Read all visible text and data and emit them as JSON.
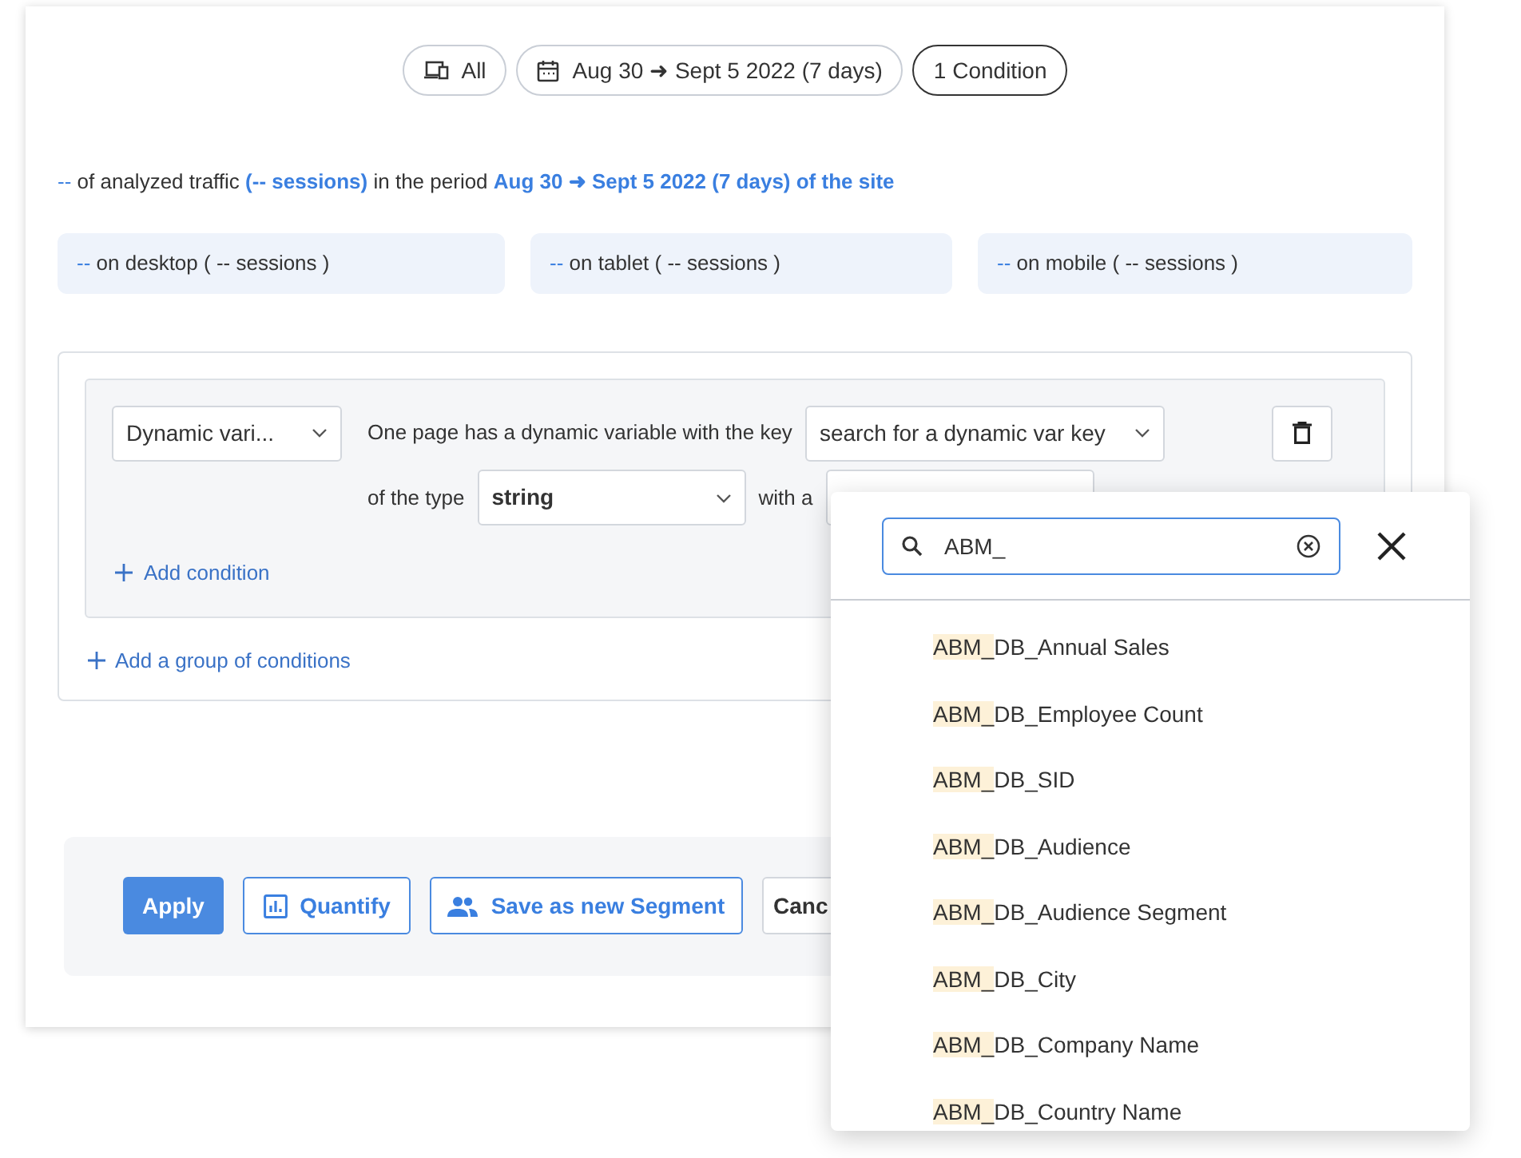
{
  "filters": [
    {
      "kind": "device",
      "label": "All",
      "selected": false
    },
    {
      "kind": "date",
      "label": "Aug 30 ➜ Sept 5 2022 (7 days)",
      "selected": false
    },
    {
      "kind": "condition",
      "label": "1 Condition",
      "selected": true
    }
  ],
  "summary": {
    "value": "--",
    "text1": "of analyzed traffic",
    "sessions": "(-- sessions)",
    "text2": "in the period",
    "period": "Aug 30 ➜ Sept 5 2022 (7 days) of the site"
  },
  "devices": [
    {
      "value": "--",
      "label": "on desktop ( -- sessions )"
    },
    {
      "value": "--",
      "label": "on tablet ( -- sessions )"
    },
    {
      "value": "--",
      "label": "on mobile ( -- sessions )"
    }
  ],
  "condition": {
    "type_select": "Dynamic vari...",
    "text1": "One page has a dynamic variable with the key",
    "key_select": "search for a dynamic var key",
    "text2": "of the type",
    "value_type": "string",
    "text3": "with a",
    "add_condition": "Add condition",
    "add_group": "Add a group of conditions"
  },
  "actions": [
    {
      "kind": "primary",
      "label": "Apply"
    },
    {
      "kind": "quantify",
      "label": "Quantify"
    },
    {
      "kind": "segment",
      "label": "Save as new Segment"
    },
    {
      "kind": "plain",
      "label": "Canc"
    }
  ],
  "popup": {
    "search_value": "ABM_",
    "items": [
      {
        "match": "ABM_",
        "rest": "DB_Annual Sales"
      },
      {
        "match": "ABM_",
        "rest": "DB_Employee Count"
      },
      {
        "match": "ABM_",
        "rest": "DB_SID"
      },
      {
        "match": "ABM_",
        "rest": "DB_Audience"
      },
      {
        "match": "ABM_",
        "rest": "DB_Audience Segment"
      },
      {
        "match": "ABM_",
        "rest": "DB_City"
      },
      {
        "match": "ABM_",
        "rest": "DB_Company Name"
      },
      {
        "match": "ABM_",
        "rest": "DB_Country Name"
      }
    ]
  }
}
